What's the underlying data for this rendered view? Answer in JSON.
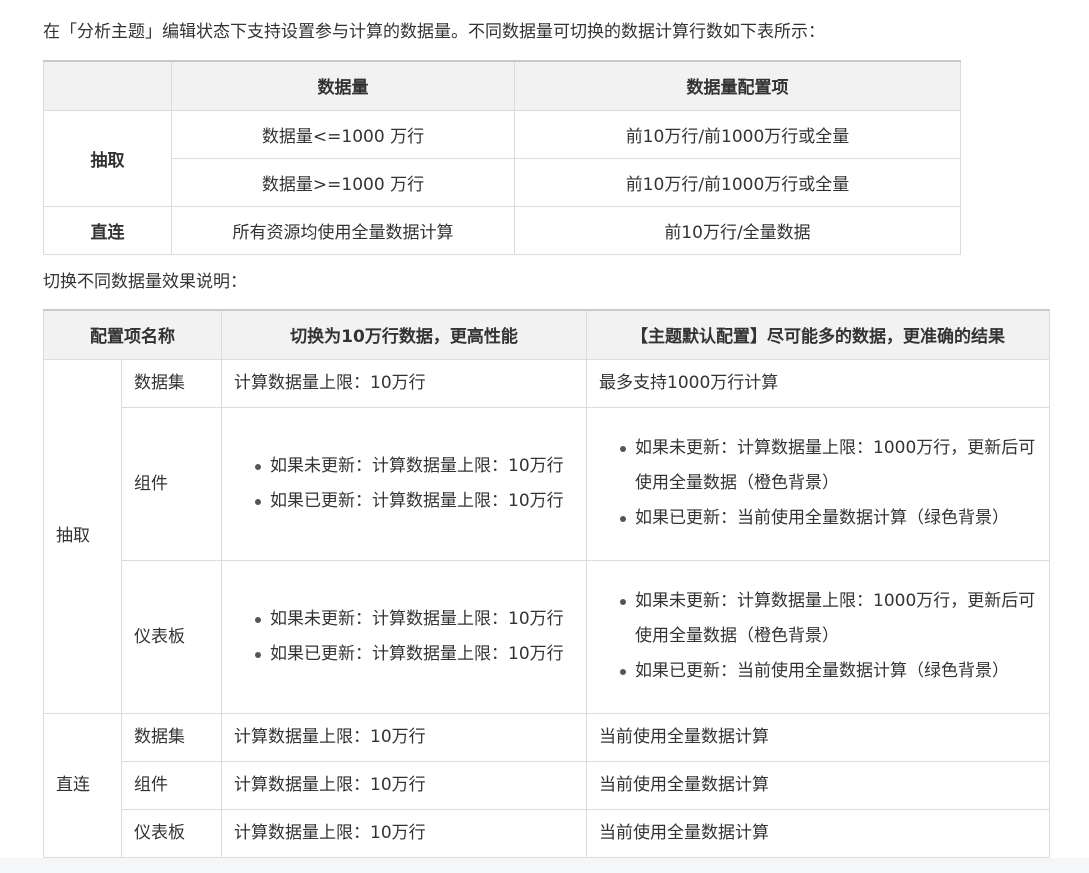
{
  "intro_text": "在「分析主题」编辑状态下支持设置参与计算的数据量。不同数据量可切换的数据计算行数如下表所示：",
  "table1": {
    "headers": [
      "",
      "数据量",
      "数据量配置项"
    ],
    "groups": [
      {
        "label": "抽取",
        "rows": [
          {
            "amount": "数据量<=1000 万行",
            "config": "前10万行/前1000万行或全量"
          },
          {
            "amount": "数据量>=1000 万行",
            "config": "前10万行/前1000万行或全量"
          }
        ]
      },
      {
        "label": "直连",
        "rows": [
          {
            "amount": "所有资源均使用全量数据计算",
            "config": "前10万行/全量数据"
          }
        ]
      }
    ]
  },
  "section_text": "切换不同数据量效果说明：",
  "table2": {
    "headers": [
      "配置项名称",
      "切换为10万行数据，更高性能",
      "【主题默认配置】尽可能多的数据，更准确的结果"
    ],
    "groups": [
      {
        "label": "抽取",
        "rows": [
          {
            "item": "数据集",
            "high_perf": "计算数据量上限：10万行",
            "default_cfg": "最多支持1000万行计算"
          },
          {
            "item": "组件",
            "high_perf": [
              "如果未更新：计算数据量上限：10万行",
              "如果已更新：计算数据量上限：10万行"
            ],
            "default_cfg": [
              "如果未更新：计算数据量上限：1000万行，更新后可使用全量数据（橙色背景）",
              "如果已更新：当前使用全量数据计算（绿色背景）"
            ]
          },
          {
            "item": "仪表板",
            "high_perf": [
              "如果未更新：计算数据量上限：10万行",
              "如果已更新：计算数据量上限：10万行"
            ],
            "default_cfg": [
              "如果未更新：计算数据量上限：1000万行，更新后可使用全量数据（橙色背景）",
              "如果已更新：当前使用全量数据计算（绿色背景）"
            ]
          }
        ]
      },
      {
        "label": "直连",
        "rows": [
          {
            "item": "数据集",
            "high_perf": "计算数据量上限：10万行",
            "default_cfg": "当前使用全量数据计算"
          },
          {
            "item": "组件",
            "high_perf": "计算数据量上限：10万行",
            "default_cfg": "当前使用全量数据计算"
          },
          {
            "item": "仪表板",
            "high_perf": "计算数据量上限：10万行",
            "default_cfg": "当前使用全量数据计算"
          }
        ]
      }
    ]
  }
}
